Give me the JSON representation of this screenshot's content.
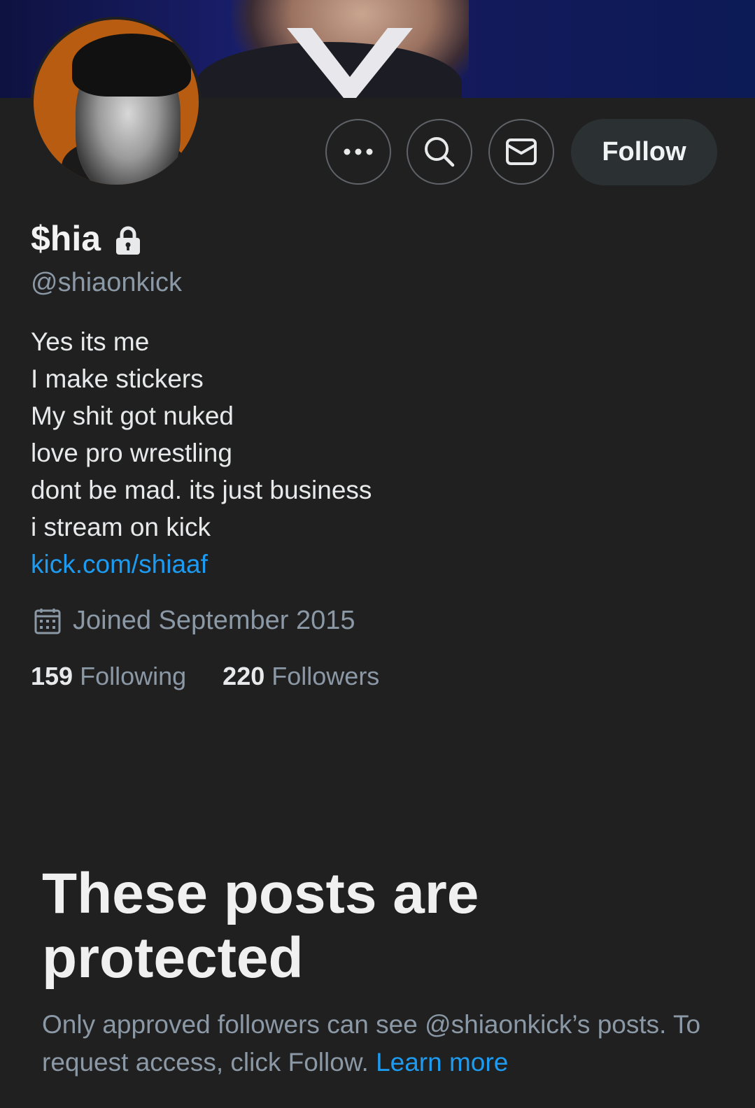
{
  "profile": {
    "display_name": "$hia",
    "handle": "@shiaonkick",
    "bio_lines": [
      "Yes its me",
      "I make stickers",
      "My shit got nuked",
      "love pro wrestling",
      "dont be mad. its just business",
      "i stream on kick"
    ],
    "link": "kick.com/shiaaf",
    "joined": "Joined September 2015",
    "following_count": "159",
    "following_label": "Following",
    "followers_count": "220",
    "followers_label": "Followers"
  },
  "actions": {
    "more_icon": "more-horizontal-icon",
    "search_icon": "search-icon",
    "message_icon": "envelope-icon",
    "follow_label": "Follow"
  },
  "protected": {
    "title": "These posts are protected",
    "description": "Only approved followers can see @shiaonkick’s posts. To request access, click Follow.",
    "learn_more": "Learn more"
  },
  "colors": {
    "background": "#202020",
    "accent": "#1d9bf0",
    "secondary_text": "#8b98a5",
    "avatar_ring": "#b85c12"
  }
}
